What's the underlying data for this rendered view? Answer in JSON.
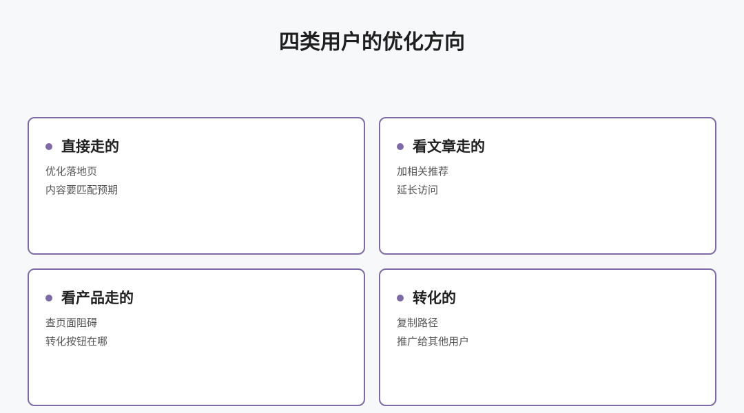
{
  "title": "四类用户的优化方向",
  "accent_color": "#7e6aa8",
  "cards": [
    {
      "heading": "直接走的",
      "lines": [
        "优化落地页",
        "内容要匹配预期"
      ]
    },
    {
      "heading": "看文章走的",
      "lines": [
        "加相关推荐",
        "延长访问"
      ]
    },
    {
      "heading": "看产品走的",
      "lines": [
        "查页面阻碍",
        "转化按钮在哪"
      ]
    },
    {
      "heading": "转化的",
      "lines": [
        "复制路径",
        "推广给其他用户"
      ]
    }
  ]
}
